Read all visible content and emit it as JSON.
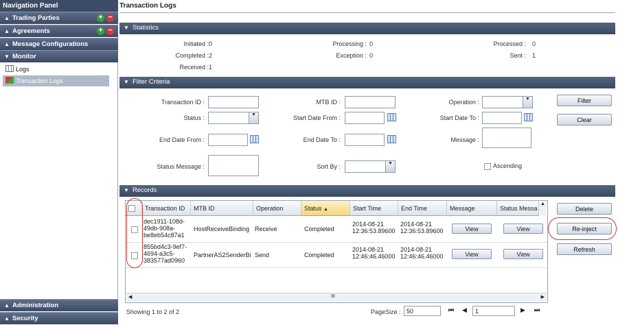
{
  "nav": {
    "title": "Navigation Panel",
    "sections": [
      {
        "label": "Trading Parties"
      },
      {
        "label": "Agreements"
      },
      {
        "label": "Message Configurations"
      },
      {
        "label": "Monitor"
      }
    ],
    "monitor_items": [
      {
        "label": "Logs"
      },
      {
        "label": "Transaction Logs"
      }
    ],
    "bottom_sections": [
      {
        "label": "Administration"
      },
      {
        "label": "Security"
      }
    ]
  },
  "page": {
    "title": "Transaction Logs"
  },
  "statistics": {
    "header": "Statistics",
    "items": [
      {
        "label": "Initiated :",
        "value": "0"
      },
      {
        "label": "Processing :",
        "value": "0"
      },
      {
        "label": "Processed :",
        "value": "0"
      },
      {
        "label": "Completed :",
        "value": "2"
      },
      {
        "label": "Exception :",
        "value": "0"
      },
      {
        "label": "Sent :",
        "value": "1"
      },
      {
        "label": "Received :",
        "value": "1"
      }
    ]
  },
  "filter": {
    "header": "Filter Criteria",
    "labels": {
      "transaction_id": "Transaction ID :",
      "mtb_id": "MTB ID :",
      "operation": "Operation :",
      "status": "Status :",
      "start_date_from": "Start Date From :",
      "start_date_to": "Start Date To :",
      "end_date_from": "End Date From :",
      "end_date_to": "End Date To :",
      "message": "Message :",
      "status_message": "Status Message :",
      "sort_by": "Sort By :",
      "ascending": "Ascending"
    },
    "buttons": {
      "filter": "Filter",
      "clear": "Clear"
    }
  },
  "records": {
    "header": "Records",
    "columns": [
      "Transaction ID",
      "MTB ID",
      "Operation",
      "Status",
      "Start Time",
      "End Time",
      "Message",
      "Status Messa"
    ],
    "rows": [
      {
        "transaction_id": [
          "dec1911-108d-",
          "49db-908a-",
          "be8eb54c87a1"
        ],
        "mtb_id": "HostReceiveBinding",
        "operation": "Receive",
        "status": "Completed",
        "start_time": [
          "2014-08-21",
          "12:36:53.89600"
        ],
        "end_time": [
          "2014-08-21",
          "12:36:53.89600"
        ],
        "message": "View",
        "status_message": "View"
      },
      {
        "transaction_id": [
          "855bd4c3-9ef7-",
          "4694-a3c5-",
          "383577ad0960"
        ],
        "mtb_id": "PartnerAS2SenderBi",
        "operation": "Send",
        "status": "Completed",
        "start_time": [
          "2014-08-21",
          "12:46:46.46000"
        ],
        "end_time": [
          "2014-08-21",
          "12:46:46.46000"
        ],
        "message": "View",
        "status_message": "View"
      }
    ],
    "scroll_glyph": "III",
    "showing": "Showing 1 to 2 of 2",
    "page_size_label": "PageSize :",
    "page_size": "50",
    "page_number": "1",
    "buttons": {
      "delete": "Delete",
      "reinject": "Re-inject",
      "refresh": "Refresh"
    }
  },
  "colors": {
    "header": "#3b4a64",
    "highlight": "#c0392b",
    "selected": "#aeb9c9"
  }
}
